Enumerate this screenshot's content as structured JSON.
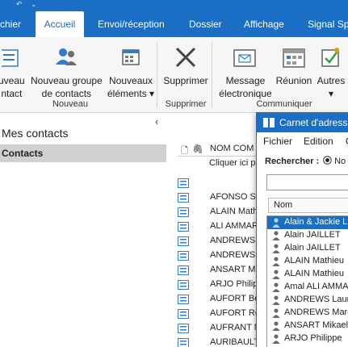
{
  "ribbon_tabs": [
    {
      "label": "chier",
      "active": false
    },
    {
      "label": "Accueil",
      "active": true
    },
    {
      "label": "Envoi/réception",
      "active": false
    },
    {
      "label": "Dossier",
      "active": false
    },
    {
      "label": "Affichage",
      "active": false
    },
    {
      "label": "Signal Spa",
      "active": false
    }
  ],
  "ribbon": {
    "new_contact": {
      "line1": "uveau",
      "line2": "ntact"
    },
    "new_group": {
      "line1": "Nouveau groupe",
      "line2": "de contacts"
    },
    "new_items": {
      "line1": "Nouveaux",
      "line2": "éléments ▾"
    },
    "delete": {
      "line1": "Supprimer"
    },
    "email": {
      "line1": "Message",
      "line2": "électronique"
    },
    "meeting": {
      "line1": "Réunion"
    },
    "more": {
      "line1": "Autres",
      "line2": "▾"
    },
    "group_new": "Nouveau",
    "group_delete": "Supprimer",
    "group_communicate": "Communiquer"
  },
  "nav": {
    "my_contacts": "Mes contacts",
    "contacts_folder": "Contacts",
    "collapse_glyph": "‹"
  },
  "list": {
    "header_name": "NOM COM",
    "new_row_hint": "Cliquer ici p",
    "rows": [
      "",
      "AFONSO S",
      "ALAIN Math",
      "ALI AMMAR",
      "ANDREWS L",
      "ANDREWS",
      "ANSART Mi",
      "ARJO Philip",
      "AUFORT Be",
      "AUFORT Re",
      "AUFRANT M",
      "AURIBAULT"
    ]
  },
  "address_book": {
    "title": "Carnet d'adresses",
    "menu": [
      "Fichier",
      "Edition",
      "O"
    ],
    "search_label": "Rechercher :",
    "radio_label": "No",
    "column_name": "Nom",
    "entries": [
      {
        "name": "Alain & Jackie L",
        "selected": true
      },
      {
        "name": "Alain JAILLET",
        "selected": false
      },
      {
        "name": "Alain JAILLET",
        "selected": false
      },
      {
        "name": "ALAIN Mathieu",
        "selected": false
      },
      {
        "name": "ALAIN Mathieu",
        "selected": false
      },
      {
        "name": "Amal ALI AMMA",
        "selected": false
      },
      {
        "name": "ANDREWS Laur",
        "selected": false
      },
      {
        "name": "ANDREWS Marc",
        "selected": false
      },
      {
        "name": "ANSART Mikael",
        "selected": false
      },
      {
        "name": "ARJO Philippe",
        "selected": false
      }
    ]
  },
  "colors": {
    "accent": "#1a6fc4",
    "selected_folder": "#d0d0d0",
    "ribbon_bg": "#f6f6f6",
    "icon_blue": "#2e7bcf",
    "icon_gray": "#7a7a7a"
  }
}
